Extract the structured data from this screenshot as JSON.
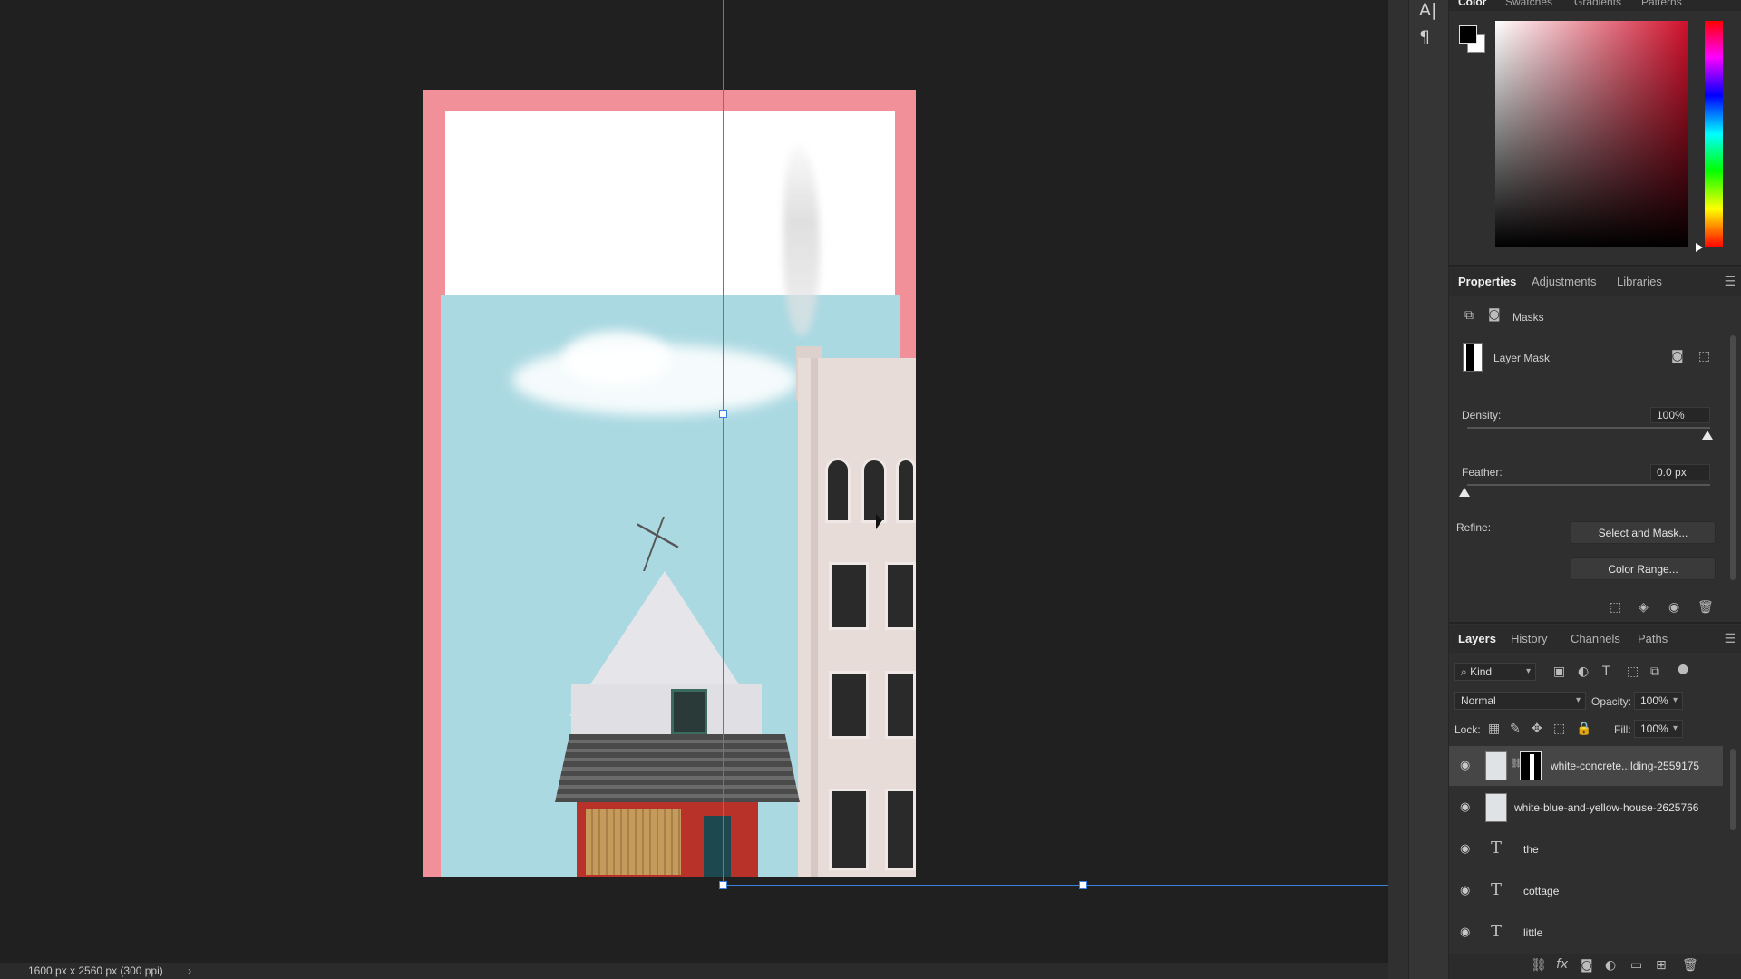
{
  "status_bar": {
    "doc_info": "1600 px x 2560 px (300 ppi)",
    "arrow": "›"
  },
  "tools": {
    "character": "A|",
    "paragraph": "¶"
  },
  "color_panel": {
    "tabs": [
      "Color",
      "Swatches",
      "Gradients",
      "Patterns"
    ],
    "foreground": "#000000",
    "background": "#ffffff",
    "hue_color": "#d0102b"
  },
  "properties": {
    "tabs": [
      "Properties",
      "Adjustments",
      "Libraries"
    ],
    "section": "Masks",
    "mask_type": "Layer Mask",
    "density_label": "Density:",
    "density_value": "100%",
    "feather_label": "Feather:",
    "feather_value": "0.0 px",
    "refine_label": "Refine:",
    "select_mask_button": "Select and Mask...",
    "color_range_button": "Color Range..."
  },
  "layers_panel": {
    "tabs": [
      "Layers",
      "History",
      "Channels",
      "Paths"
    ],
    "filter_kind": "Kind",
    "blend_mode": "Normal",
    "opacity_label": "Opacity:",
    "opacity_value": "100%",
    "lock_label": "Lock:",
    "fill_label": "Fill:",
    "fill_value": "100%",
    "layers": [
      {
        "name": "white-concrete...lding-2559175",
        "type": "image-mask",
        "selected": true
      },
      {
        "name": "white-blue-and-yellow-house-2625766",
        "type": "image",
        "selected": false
      },
      {
        "name": "the",
        "type": "text",
        "selected": false
      },
      {
        "name": "cottage",
        "type": "text",
        "selected": false
      },
      {
        "name": "little",
        "type": "text",
        "selected": false
      }
    ]
  }
}
